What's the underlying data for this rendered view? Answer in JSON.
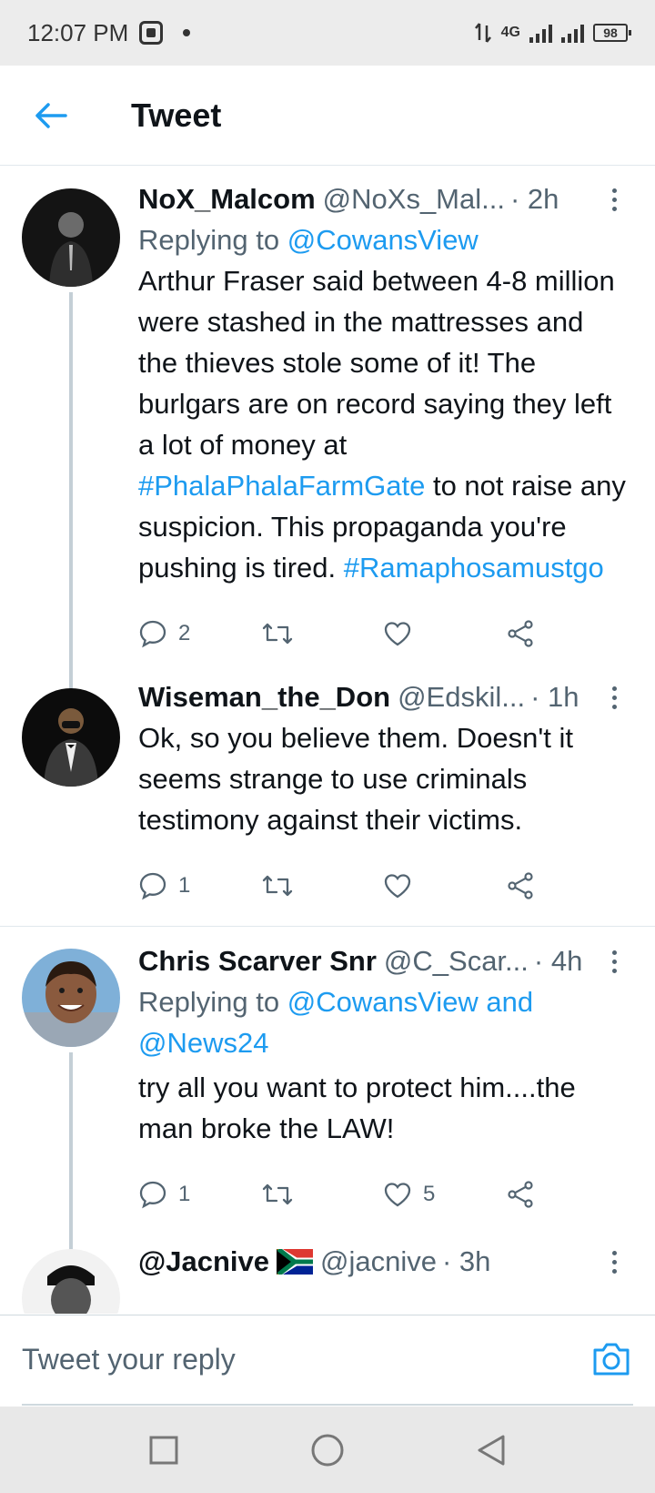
{
  "status_bar": {
    "time": "12:07 PM",
    "network": "4G",
    "battery": "98"
  },
  "header": {
    "title": "Tweet"
  },
  "tweets": [
    {
      "name": "NoX_Malcom",
      "handle": "@NoXs_Mal...",
      "time": "· 2h",
      "reply_prefix": "Replying to",
      "reply_to": "@CowansView",
      "text_parts": [
        "Arthur Fraser said between 4-8 million were stashed in the mattresses and the thieves stole some of it! The burlgars are on record saying they left a lot of money at ",
        "#PhalaPhalaFarmGate",
        " to not raise any suspicion. This propaganda you're pushing is tired. ",
        "#Ramaphosamustgo"
      ],
      "replies": "2",
      "retweets": "",
      "likes": ""
    },
    {
      "name": "Wiseman_the_Don",
      "handle": "@Edskil...",
      "time": "· 1h",
      "text": "Ok, so you believe them. Doesn't it seems strange to use criminals testimony against their victims.",
      "replies": "1",
      "retweets": "",
      "likes": ""
    },
    {
      "name": "Chris Scarver Snr",
      "handle": "@C_Scar...",
      "time": "· 4h",
      "reply_prefix": "Replying to",
      "reply_to": "@CowansView and @News24",
      "text": "try all you want to protect him....the man broke the LAW!",
      "replies": "1",
      "retweets": "",
      "likes": "5"
    },
    {
      "name": "@Jacnive",
      "handle": "@jacnive",
      "time": "· 3h"
    }
  ],
  "reply_box": {
    "placeholder": "Tweet your reply"
  },
  "colors": {
    "accent": "#1d9bf0",
    "text": "#0f1419",
    "muted": "#536471"
  },
  "icons": {
    "back": "arrow-left-icon",
    "reply": "comment-icon",
    "retweet": "retweet-icon",
    "like": "heart-icon",
    "share": "share-icon",
    "camera": "camera-icon",
    "flag": "south-africa-flag-icon"
  }
}
